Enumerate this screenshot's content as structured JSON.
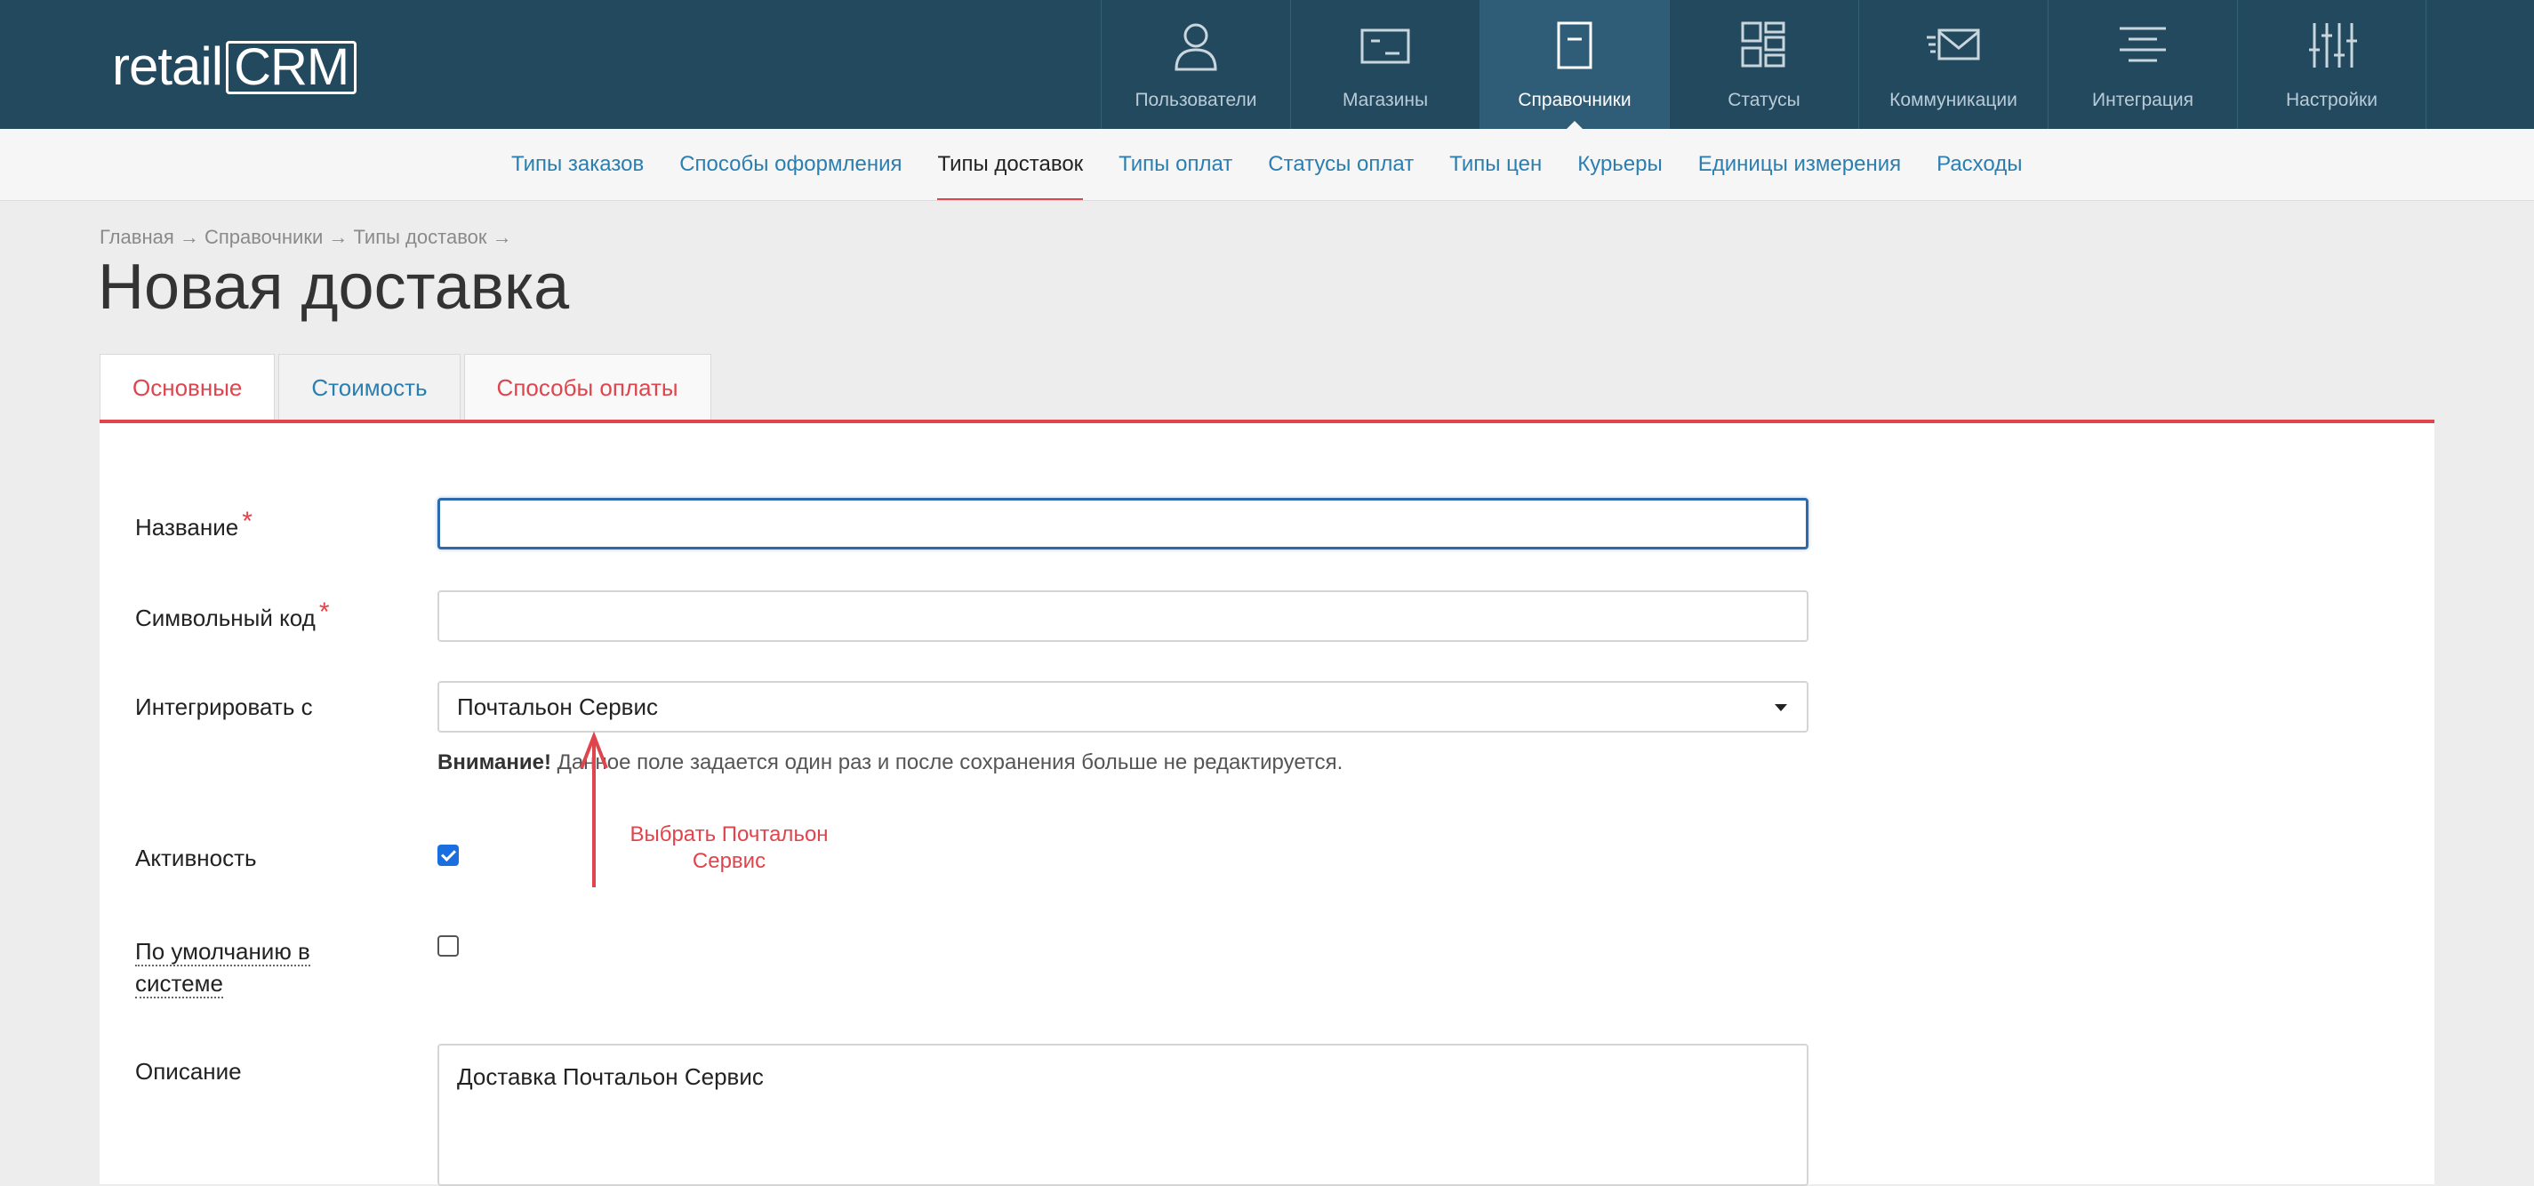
{
  "header": {
    "logo_text": "retail",
    "logo_box_text": "CRM",
    "nav": [
      {
        "label": "Пользователи",
        "icon": "user-icon",
        "active": false
      },
      {
        "label": "Магазины",
        "icon": "store-icon",
        "active": false
      },
      {
        "label": "Справочники",
        "icon": "book-icon",
        "active": true
      },
      {
        "label": "Статусы",
        "icon": "status-grid-icon",
        "active": false
      },
      {
        "label": "Коммуникации",
        "icon": "mail-icon",
        "active": false
      },
      {
        "label": "Интеграция",
        "icon": "integration-icon",
        "active": false
      },
      {
        "label": "Настройки",
        "icon": "sliders-icon",
        "active": false
      }
    ]
  },
  "subnav": [
    {
      "label": "Типы заказов",
      "active": false
    },
    {
      "label": "Способы оформления",
      "active": false
    },
    {
      "label": "Типы доставок",
      "active": true
    },
    {
      "label": "Типы оплат",
      "active": false
    },
    {
      "label": "Статусы оплат",
      "active": false
    },
    {
      "label": "Типы цен",
      "active": false
    },
    {
      "label": "Курьеры",
      "active": false
    },
    {
      "label": "Единицы измерения",
      "active": false
    },
    {
      "label": "Расходы",
      "active": false
    }
  ],
  "breadcrumb": "Главная → Справочники → Типы доставок →",
  "page_title": "Новая доставка",
  "tabs": [
    {
      "label": "Основные",
      "active": true
    },
    {
      "label": "Стоимость",
      "active": false
    },
    {
      "label": "Способы оплаты",
      "active": false
    }
  ],
  "form": {
    "name_label": "Название",
    "name_value": "",
    "code_label": "Символьный код",
    "code_value": "",
    "integrate_label": "Интегрировать с",
    "integrate_value": "Почтальон Сервис",
    "hint_bold": "Внимание!",
    "hint_text": " Данное поле задается один раз и после сохранения больше не редактируется.",
    "active_label": "Активность",
    "active_checked": true,
    "default_label_1": "По умолчанию в",
    "default_label_2": "системе",
    "default_checked": false,
    "description_label": "Описание",
    "description_value": "Доставка Почтальон Сервис",
    "required_mark": "*"
  },
  "annotation": {
    "line1": "Выбрать Почтальон",
    "line2": "Сервис",
    "color": "#e0444c"
  },
  "colors": {
    "header_bg": "#23495f",
    "accent_red": "#e0444c",
    "link_blue": "#2a7fb0",
    "checkbox_blue": "#1a6fe0"
  }
}
